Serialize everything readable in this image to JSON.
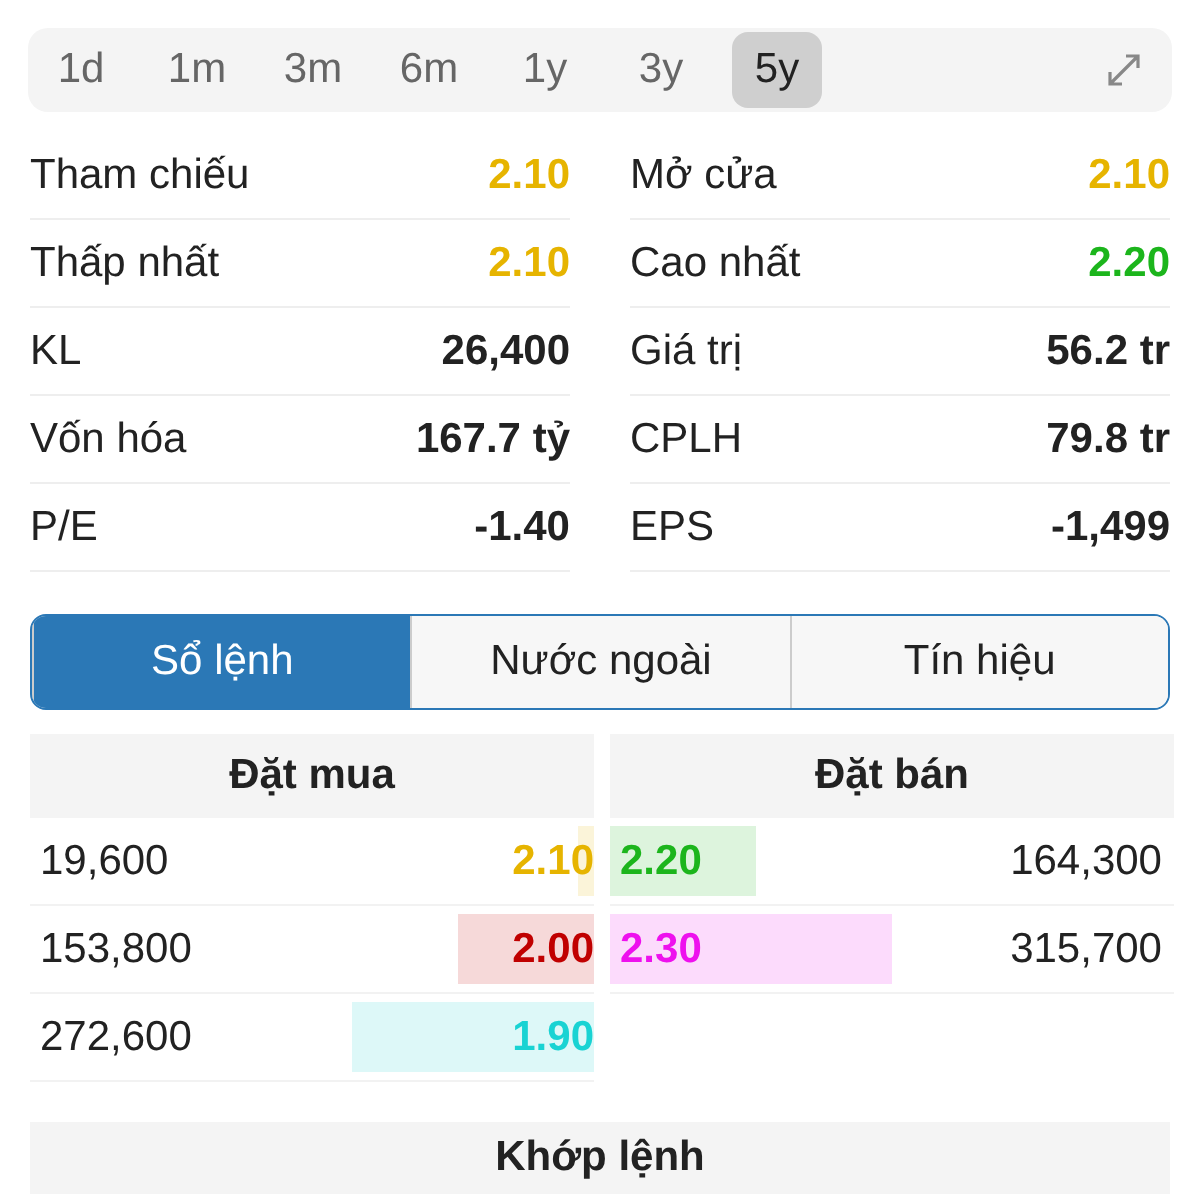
{
  "periods": [
    {
      "label": "1d",
      "selected": false
    },
    {
      "label": "1m",
      "selected": false
    },
    {
      "label": "3m",
      "selected": false
    },
    {
      "label": "6m",
      "selected": false
    },
    {
      "label": "1y",
      "selected": false
    },
    {
      "label": "3y",
      "selected": false
    },
    {
      "label": "5y",
      "selected": true
    }
  ],
  "stats": [
    {
      "label": "Tham chiếu",
      "value": "2.10",
      "color": "#e6b400"
    },
    {
      "label": "Mở cửa",
      "value": "2.10",
      "color": "#e6b400"
    },
    {
      "label": "Thấp nhất",
      "value": "2.10",
      "color": "#e6b400"
    },
    {
      "label": "Cao nhất",
      "value": "2.20",
      "color": "#1cb51c"
    },
    {
      "label": "KL",
      "value": "26,400"
    },
    {
      "label": "Giá trị",
      "value": "56.2 tr"
    },
    {
      "label": "Vốn hóa",
      "value": "167.7 tỷ"
    },
    {
      "label": "CPLH",
      "value": "79.8 tr"
    },
    {
      "label": "P/E",
      "value": "-1.40"
    },
    {
      "label": "EPS",
      "value": "-1,499"
    }
  ],
  "tabs": [
    {
      "label": "Sổ lệnh",
      "selected": true
    },
    {
      "label": "Nước ngoài",
      "selected": false
    },
    {
      "label": "Tín hiệu",
      "selected": false
    }
  ],
  "order_book": {
    "buy_header": "Đặt mua",
    "sell_header": "Đặt bán",
    "buy": [
      {
        "volume": "19,600",
        "price": "2.10",
        "color": "#e6b400",
        "level": 0.03
      },
      {
        "volume": "153,800",
        "price": "2.00",
        "color": "#c00000",
        "level": 0.24
      },
      {
        "volume": "272,600",
        "price": "1.90",
        "color": "#19d3d3",
        "level": 0.43
      }
    ],
    "sell": [
      {
        "volume": "164,300",
        "price": "2.20",
        "color": "#1cb51c",
        "level": 0.26
      },
      {
        "volume": "315,700",
        "price": "2.30",
        "color": "#ee10ee",
        "level": 0.5
      }
    ]
  },
  "matched_header": "Khớp lệnh"
}
